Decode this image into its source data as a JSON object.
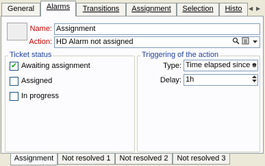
{
  "tabs": [
    {
      "label": "General"
    },
    {
      "label": "Alarms"
    },
    {
      "label": "Transitions"
    },
    {
      "label": "Assignment"
    },
    {
      "label": "Selection"
    },
    {
      "label": "Histo"
    }
  ],
  "tab_nav": {
    "prev": "◀",
    "next": "▶"
  },
  "form": {
    "name_label": "Name:",
    "name_value": "Assignment",
    "action_label": "Action:",
    "action_value": "HD Alarm not assigned",
    "action_icons": [
      "magnifier-icon",
      "details-icon",
      "dropdown-arrow-icon"
    ]
  },
  "ticket_status": {
    "title": "Ticket status",
    "items": [
      {
        "label": "Awaiting assignment",
        "checked": true
      },
      {
        "label": "Assigned",
        "checked": false
      },
      {
        "label": "In progress",
        "checked": false
      }
    ]
  },
  "triggering": {
    "title": "Triggering of the action",
    "type_label": "Type:",
    "type_value": "Time elapsed since o",
    "delay_label": "Delay:",
    "delay_value": "1h"
  },
  "bottom_tabs": [
    {
      "label": "Assignment"
    },
    {
      "label": "Not resolved 1"
    },
    {
      "label": "Not resolved 2"
    },
    {
      "label": "Not resolved 3"
    }
  ]
}
